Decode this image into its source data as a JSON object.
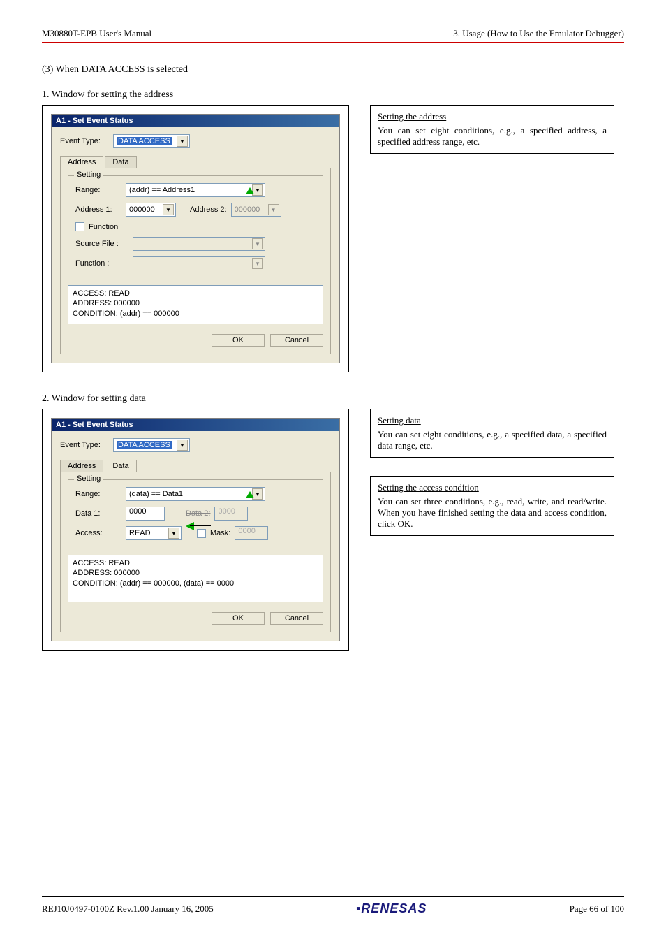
{
  "header": {
    "left": "M30880T-EPB User's Manual",
    "right": "3. Usage (How to Use the Emulator Debugger)"
  },
  "section_title": "(3) When DATA ACCESS is selected",
  "part1": {
    "title": "1. Window for setting the address",
    "dialog_title": "A1 - Set Event Status",
    "event_type_label": "Event Type:",
    "event_type_value": "DATA ACCESS",
    "tab_address": "Address",
    "tab_data": "Data",
    "fieldset_legend": "Setting",
    "range_label": "Range:",
    "range_value": "(addr) == Address1",
    "address1_label": "Address 1:",
    "address1_value": "000000",
    "address2_label": "Address 2:",
    "address2_value": "000000",
    "function_check": "Function",
    "source_file_label": "Source File :",
    "function_label": "Function :",
    "summary": "ACCESS: READ\nADDRESS: 000000\nCONDITION: (addr) == 000000",
    "ok": "OK",
    "cancel": "Cancel",
    "callout_title": "Setting the address",
    "callout_text": "You can set eight conditions, e.g., a specified address, a specified address range, etc."
  },
  "part2": {
    "title": "2. Window for setting data",
    "dialog_title": "A1 - Set Event Status",
    "event_type_label": "Event Type:",
    "event_type_value": "DATA ACCESS",
    "tab_address": "Address",
    "tab_data": "Data",
    "fieldset_legend": "Setting",
    "range_label": "Range:",
    "range_value": "(data) == Data1",
    "data1_label": "Data 1:",
    "data1_value": "0000",
    "data2_label": "Data 2:",
    "data2_value": "0000",
    "access_label": "Access:",
    "access_value": "READ",
    "mask_label": "Mask:",
    "mask_value": "0000",
    "summary": "ACCESS: READ\nADDRESS: 000000\nCONDITION: (addr) == 000000, (data) == 0000",
    "ok": "OK",
    "cancel": "Cancel",
    "callout1_title": "Setting data",
    "callout1_text": "You can set eight conditions, e.g., a specified data, a specified data range, etc.",
    "callout2_title": "Setting the access condition",
    "callout2_text": "You can set three conditions, e.g., read, write, and read/write. When you have finished setting the data and access condition, click OK."
  },
  "footer": {
    "left": "REJ10J0497-0100Z   Rev.1.00   January 16, 2005",
    "right": "Page 66 of 100",
    "logo": "RENESAS"
  }
}
